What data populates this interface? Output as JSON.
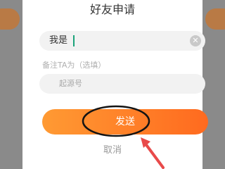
{
  "dialog": {
    "title": "好友申请",
    "request_prefix": "我是",
    "remark_label": "备注TA为（选填）",
    "remark_placeholder": "起源号",
    "send_label": "发送",
    "cancel_label": "取消"
  },
  "icons": {
    "clear": "close-circle-icon"
  },
  "colors": {
    "accent_start": "#ff9a33",
    "accent_end": "#ff6a1f",
    "annotation": "#e84a4a",
    "caret": "#1aa37a"
  }
}
